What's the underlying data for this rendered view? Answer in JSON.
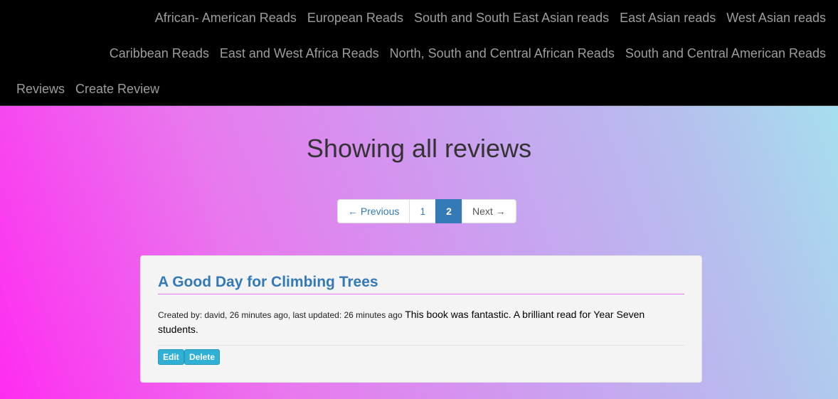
{
  "nav": {
    "row1": [
      "African- American Reads",
      "European Reads",
      "South and South East Asian reads",
      "East Asian reads",
      "West Asian reads"
    ],
    "row2": [
      "Caribbean Reads",
      "East and West Africa Reads",
      "North, South and Central African Reads",
      "South and Central American Reads"
    ],
    "row3": [
      "Reviews",
      "Create Review"
    ]
  },
  "page": {
    "title": "Showing all reviews"
  },
  "pagination": {
    "previous": "← Previous",
    "pages": [
      "1",
      "2"
    ],
    "active_page": "2",
    "next": "Next →"
  },
  "review": {
    "title": "A Good Day for Climbing Trees",
    "meta": "Created by: david, 26 minutes ago, last updated: 26 minutes ago",
    "body": "This book was fantastic. A brilliant read for Year Seven students.",
    "edit_label": "Edit",
    "delete_label": "Delete"
  },
  "colors": {
    "navbar_bg": "#000000",
    "nav_link": "#9d9d9d",
    "link_blue": "#337ab7",
    "info_button": "#31b0d5",
    "gradient_start": "#ff2cf0",
    "gradient_end": "#a2e6ee"
  }
}
